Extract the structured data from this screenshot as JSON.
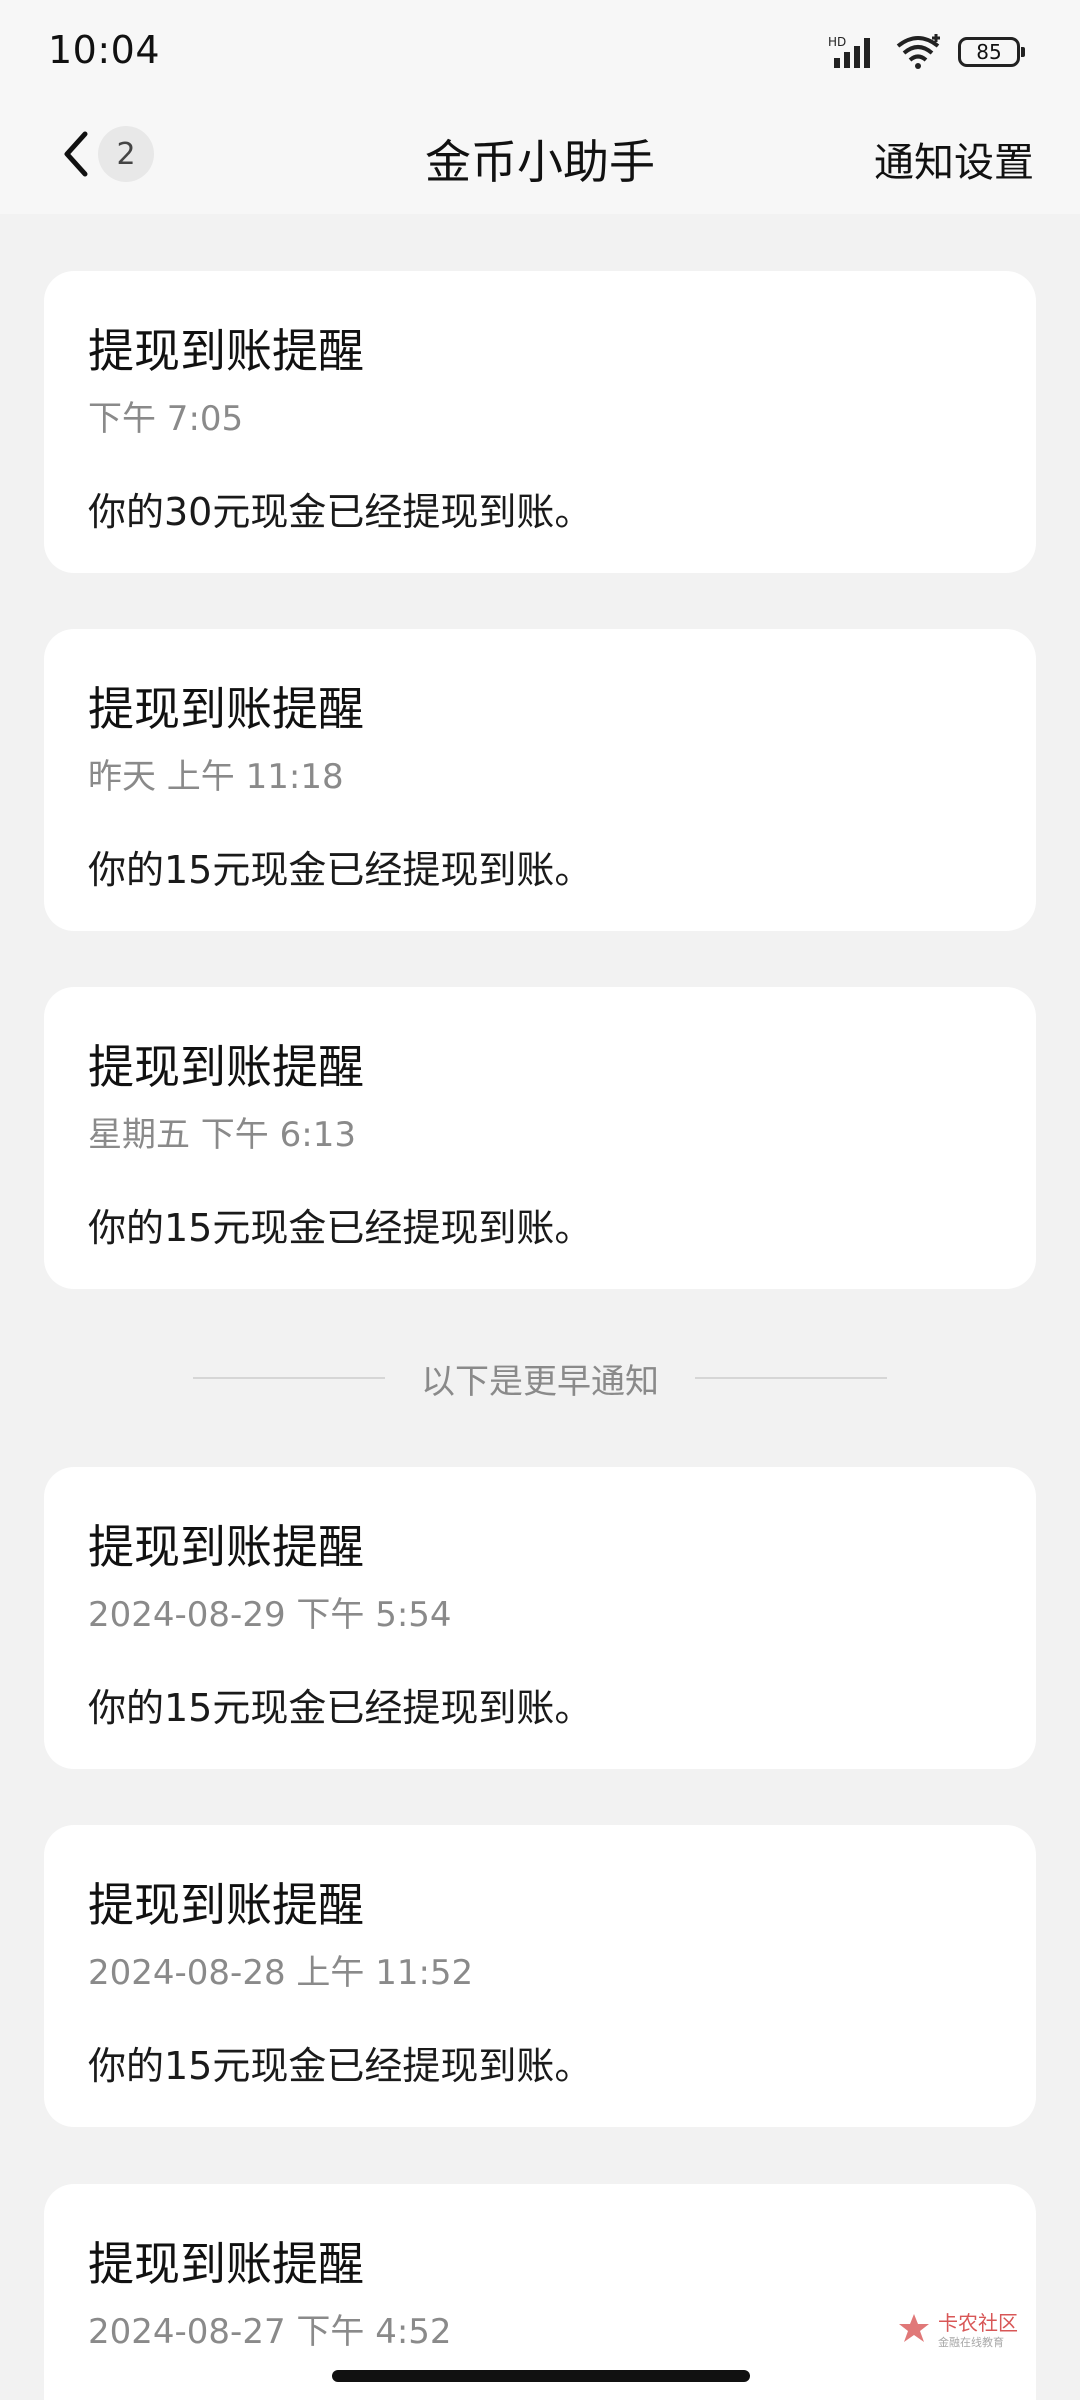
{
  "status_bar": {
    "time": "10:04",
    "hd_label": "HD",
    "battery": "85"
  },
  "header": {
    "back_icon": "chevron-left-icon",
    "count": "2",
    "title": "金币小助手",
    "settings": "通知设置"
  },
  "notifications": [
    {
      "title": "提现到账提醒",
      "time": "下午 7:05",
      "body": "你的30元现金已经提现到账。"
    },
    {
      "title": "提现到账提醒",
      "time": "昨天 上午 11:18",
      "body": "你的15元现金已经提现到账。"
    },
    {
      "title": "提现到账提醒",
      "time": "星期五 下午 6:13",
      "body": "你的15元现金已经提现到账。"
    }
  ],
  "divider": {
    "label": "以下是更早通知"
  },
  "earlier_notifications": [
    {
      "title": "提现到账提醒",
      "time": "2024-08-29 下午 5:54",
      "body": "你的15元现金已经提现到账。"
    },
    {
      "title": "提现到账提醒",
      "time": "2024-08-28 上午 11:52",
      "body": "你的15元现金已经提现到账。"
    },
    {
      "title": "提现到账提醒",
      "time": "2024-08-27 下午 4:52",
      "body": ""
    }
  ],
  "watermark": {
    "main": "卡农社区",
    "sub": "金融在线教育"
  },
  "colors": {
    "background": "#f2f2f2",
    "card": "#ffffff",
    "secondary_text": "#8a8a8a",
    "watermark": "#d23a3a"
  }
}
